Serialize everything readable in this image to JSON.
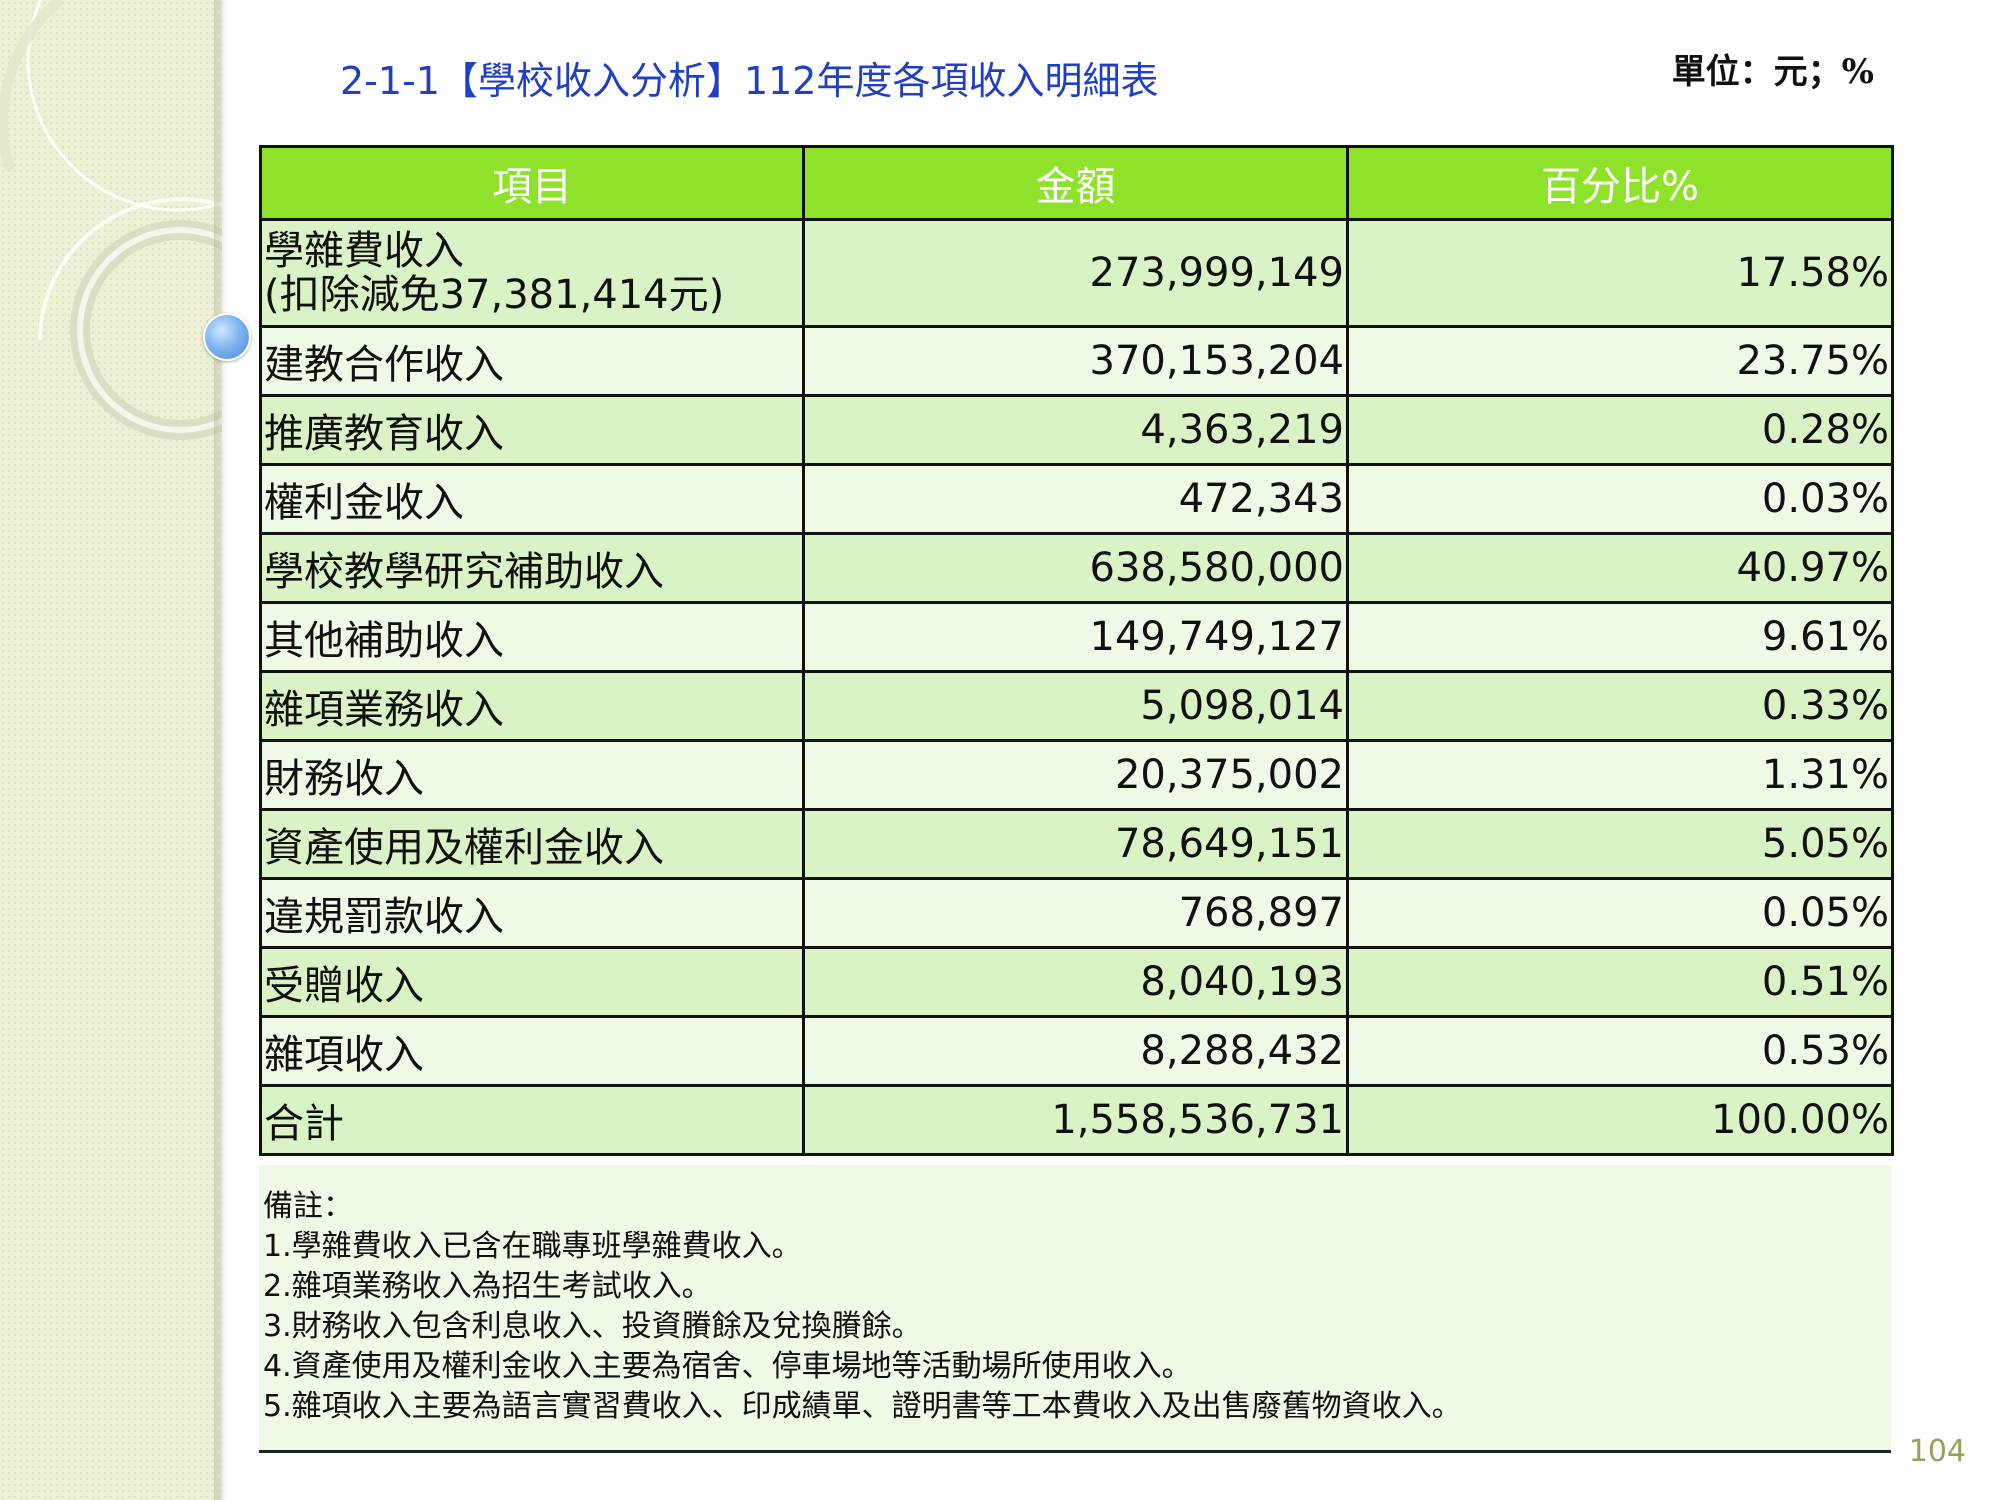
{
  "title": "2-1-1【學校收入分析】112年度各項收入明細表",
  "unit": "單位：元；%",
  "table": {
    "headers": [
      "項目",
      "金額",
      "百分比%"
    ],
    "rows": [
      {
        "name": "學雜費收入",
        "note": "(扣除減免37,381,414元)",
        "amount": "273,999,149",
        "percent": "17.58%"
      },
      {
        "name": "建教合作收入",
        "amount": "370,153,204",
        "percent": "23.75%"
      },
      {
        "name": "推廣教育收入",
        "amount": "4,363,219",
        "percent": "0.28%"
      },
      {
        "name": "權利金收入",
        "amount": "472,343",
        "percent": "0.03%"
      },
      {
        "name": "學校教學研究補助收入",
        "amount": "638,580,000",
        "percent": "40.97%"
      },
      {
        "name": "其他補助收入",
        "amount": "149,749,127",
        "percent": "9.61%"
      },
      {
        "name": "雜項業務收入",
        "amount": "5,098,014",
        "percent": "0.33%"
      },
      {
        "name": "財務收入",
        "amount": "20,375,002",
        "percent": "1.31%"
      },
      {
        "name": "資產使用及權利金收入",
        "amount": "78,649,151",
        "percent": "5.05%"
      },
      {
        "name": "違規罰款收入",
        "amount": "768,897",
        "percent": "0.05%"
      },
      {
        "name": "受贈收入",
        "amount": "8,040,193",
        "percent": "0.51%"
      },
      {
        "name": "雜項收入",
        "amount": "8,288,432",
        "percent": "0.53%"
      },
      {
        "name": "合計",
        "amount": "1,558,536,731",
        "percent": "100.00%"
      }
    ]
  },
  "notes": {
    "heading": "備註：",
    "items": [
      "1.學雜費收入已含在職專班學雜費收入。",
      "2.雜項業務收入為招生考試收入。",
      "3.財務收入包含利息收入、投資賸餘及兌換賸餘。",
      "4.資產使用及權利金收入主要為宿舍、停車場地等活動場所使用收入。",
      "5.雜項收入主要為語言實習費收入、印成績單、證明書等工本費收入及出售廢舊物資收入。"
    ]
  },
  "page_number": "104",
  "colors": {
    "header_bg": "#8fe22a",
    "row_dark": "#d9f2c6",
    "row_light": "#eef9e6",
    "title": "#1f3fc4",
    "left_panel": "#eef0d6"
  }
}
